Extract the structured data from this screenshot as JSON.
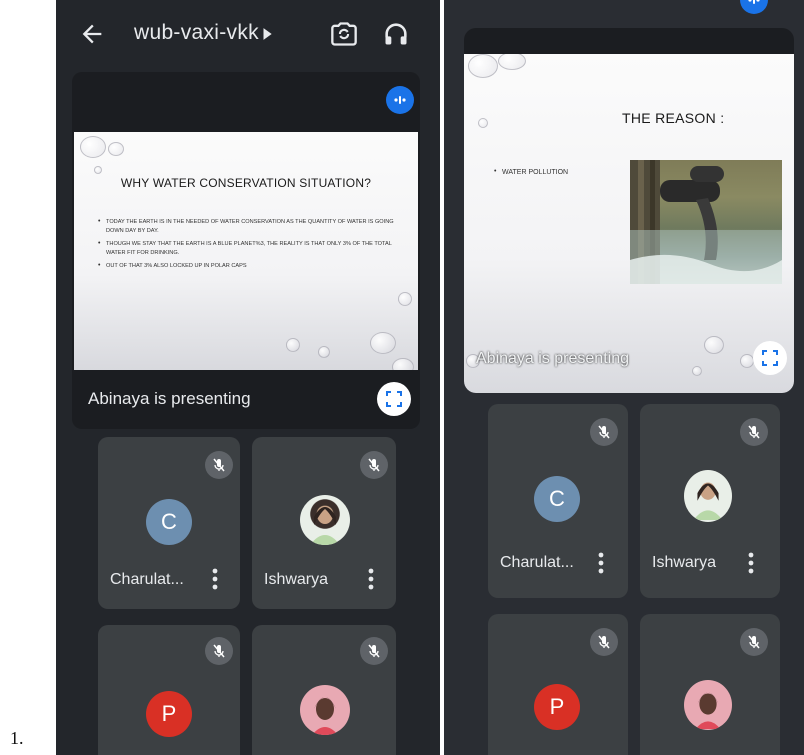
{
  "list_number": "1.",
  "left_screen": {
    "meeting_code": "wub-vaxi-vkk",
    "presentation": {
      "slide_title": "WHY WATER CONSERVATION SITUATION?",
      "bullets": [
        "Today the earth is in the needed of water conservation as the quantity of water is going down day by day.",
        "Though we stay that the earth is a blue planet%3, the reality is that only 3% of the total water fit for drinking.",
        "Out of that 3% also locked up in polar caps"
      ],
      "presenting_text": "Abinaya is presenting"
    },
    "participants": [
      {
        "name": "Charulat...",
        "avatar_letter": "C",
        "avatar_color": "#6d8fb0",
        "muted": true
      },
      {
        "name": "Ishwarya",
        "avatar_letter": "",
        "avatar_color": "#d9d2c3",
        "muted": true
      },
      {
        "name": "",
        "avatar_letter": "P",
        "avatar_color": "#d93025",
        "muted": true
      },
      {
        "name": "",
        "avatar_letter": "",
        "avatar_color": "#e8a9b3",
        "muted": true
      }
    ]
  },
  "right_screen": {
    "presentation": {
      "slide_title": "THE REASON :",
      "bullets": [
        "WATER POLLUTION"
      ],
      "presenting_text": "Abinaya is presenting"
    },
    "participants": [
      {
        "name": "Charulat...",
        "avatar_letter": "C",
        "avatar_color": "#6d8fb0",
        "muted": true
      },
      {
        "name": "Ishwarya",
        "avatar_letter": "",
        "avatar_color": "#d9d2c3",
        "muted": true
      },
      {
        "name": "",
        "avatar_letter": "P",
        "avatar_color": "#d93025",
        "muted": true
      },
      {
        "name": "",
        "avatar_letter": "",
        "avatar_color": "#e8a9b3",
        "muted": true
      }
    ]
  },
  "icons": {
    "back": "arrow-back-icon",
    "switch_camera": "switch-camera-icon",
    "audio": "headphones-icon",
    "fullscreen": "fullscreen-icon",
    "mute": "mic-off-icon",
    "more": "more-vert-icon",
    "pin": "pin-icon"
  },
  "colors": {
    "background": "#23262b",
    "tile": "#3c4043",
    "accent_blue": "#1a73e8",
    "text": "#e8eaed"
  }
}
